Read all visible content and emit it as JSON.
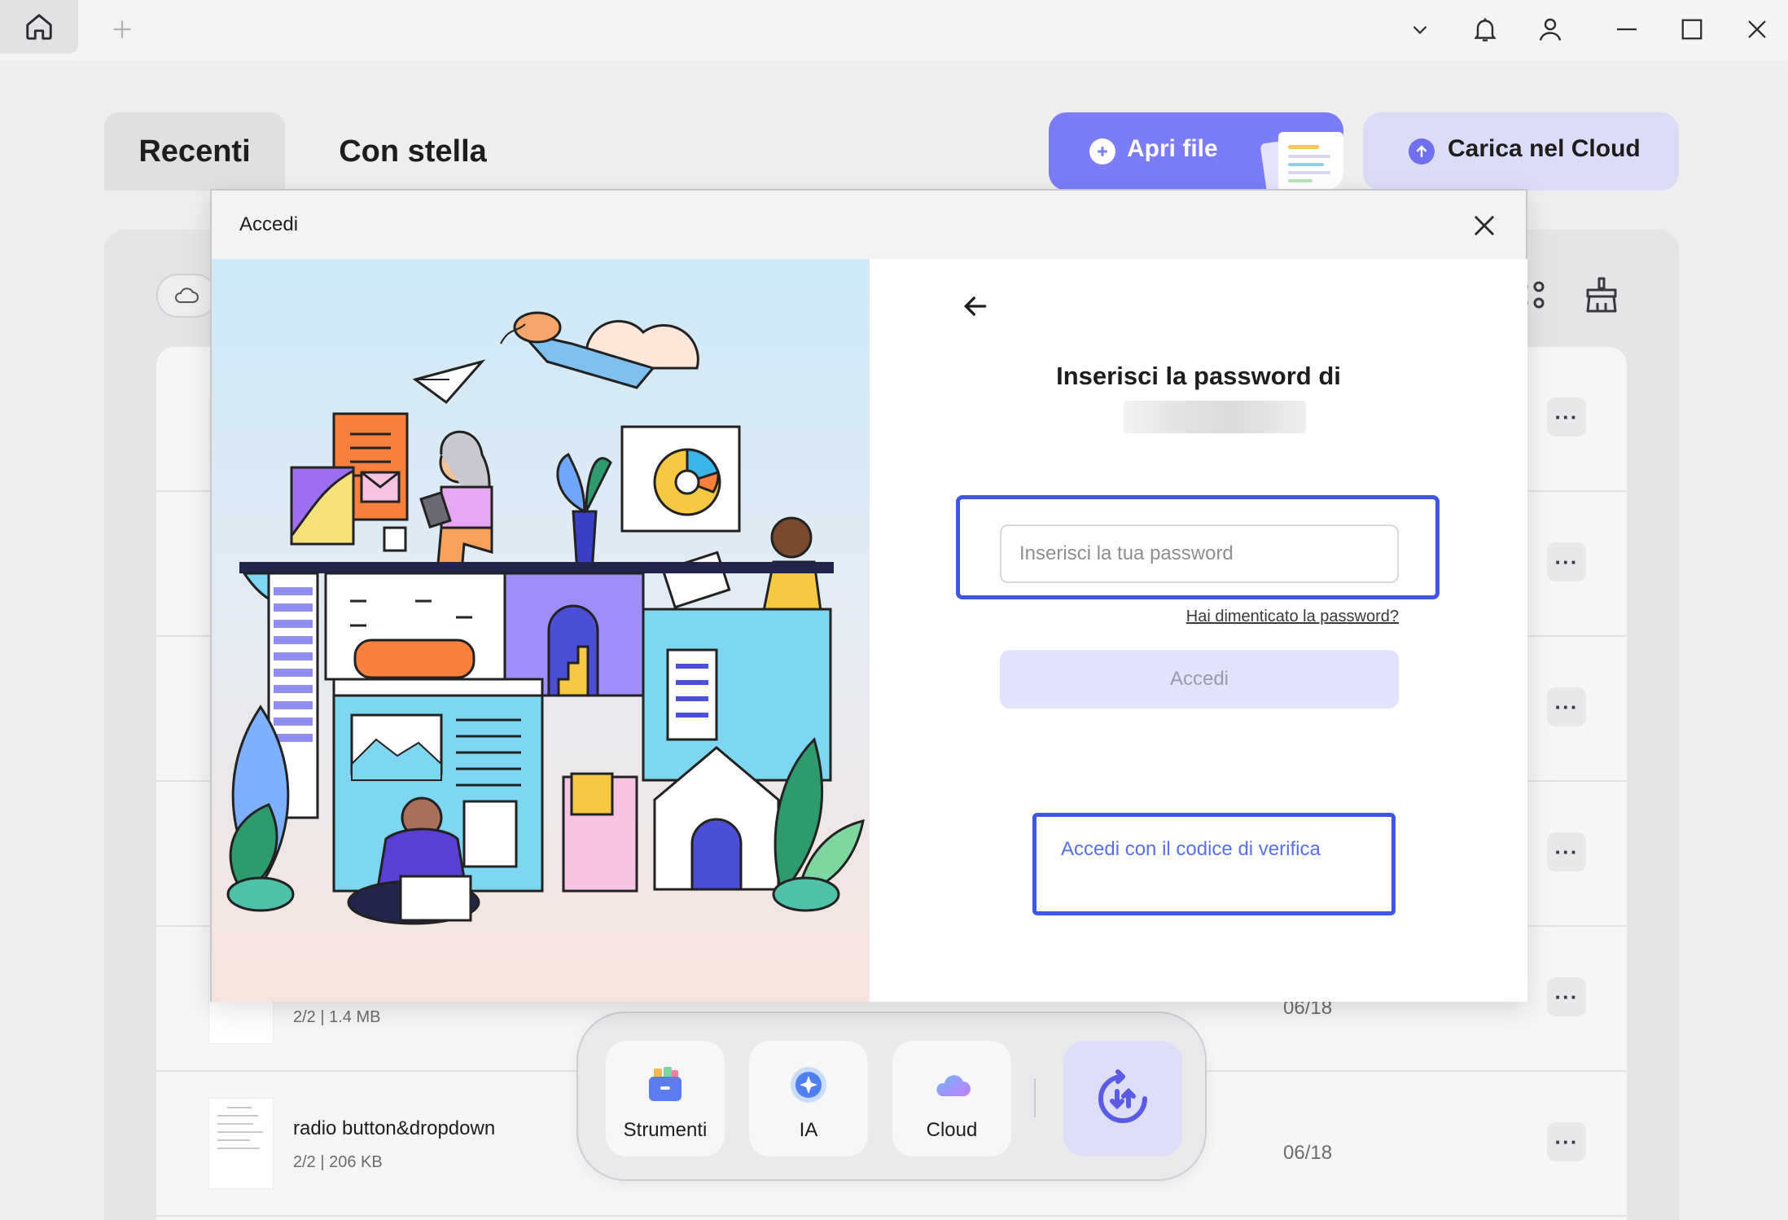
{
  "tabs": {
    "recent": "Recenti",
    "starred": "Con stella"
  },
  "actions": {
    "open_file": "Apri file",
    "upload_cloud": "Carica nel Cloud"
  },
  "files": [
    {
      "name": "",
      "meta": "",
      "date": ""
    },
    {
      "name": "",
      "meta": "",
      "date": ""
    },
    {
      "name": "",
      "meta": "",
      "date": ""
    },
    {
      "name": "",
      "meta": "",
      "date": ""
    },
    {
      "name": "",
      "meta": "2/2 | 1.4 MB",
      "date": "06/18"
    },
    {
      "name": "radio button&dropdown",
      "meta": "2/2 | 206 KB",
      "date": "06/18"
    }
  ],
  "dock": {
    "tools": "Strumenti",
    "ai": "IA",
    "cloud": "Cloud"
  },
  "modal": {
    "title": "Accedi",
    "heading": "Inserisci la password di",
    "password_placeholder": "Inserisci la tua password",
    "forgot": "Hai dimenticato la password?",
    "login_button": "Accedi",
    "verification_link": "Accedi con il codice di verifica"
  },
  "colors": {
    "accent": "#7b7cf6",
    "highlight": "#3d56e4",
    "link": "#5a6ee8"
  }
}
